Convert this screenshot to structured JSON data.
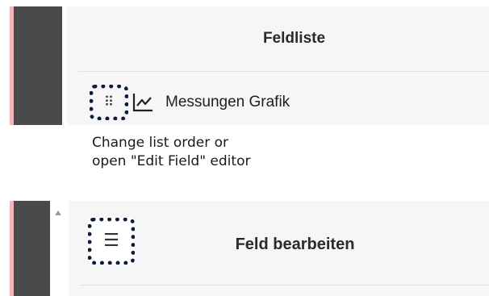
{
  "field_list": {
    "title": "Feldliste",
    "items": [
      {
        "label": "Messungen Grafik",
        "icon": "line-chart-icon",
        "handle_icon": "drag-handle-icon"
      }
    ]
  },
  "caption": {
    "line1": "Change list order or",
    "line2": "open \"Edit Field\" editor"
  },
  "edit_field": {
    "title": "Feld bearbeiten",
    "menu_icon": "hamburger-menu-icon"
  },
  "colors": {
    "dark_rail": "#4a4a4a",
    "pink_edge": "#f2b6b6",
    "panel_bg": "#f6f6f6",
    "highlight": "#0d1b3d"
  }
}
